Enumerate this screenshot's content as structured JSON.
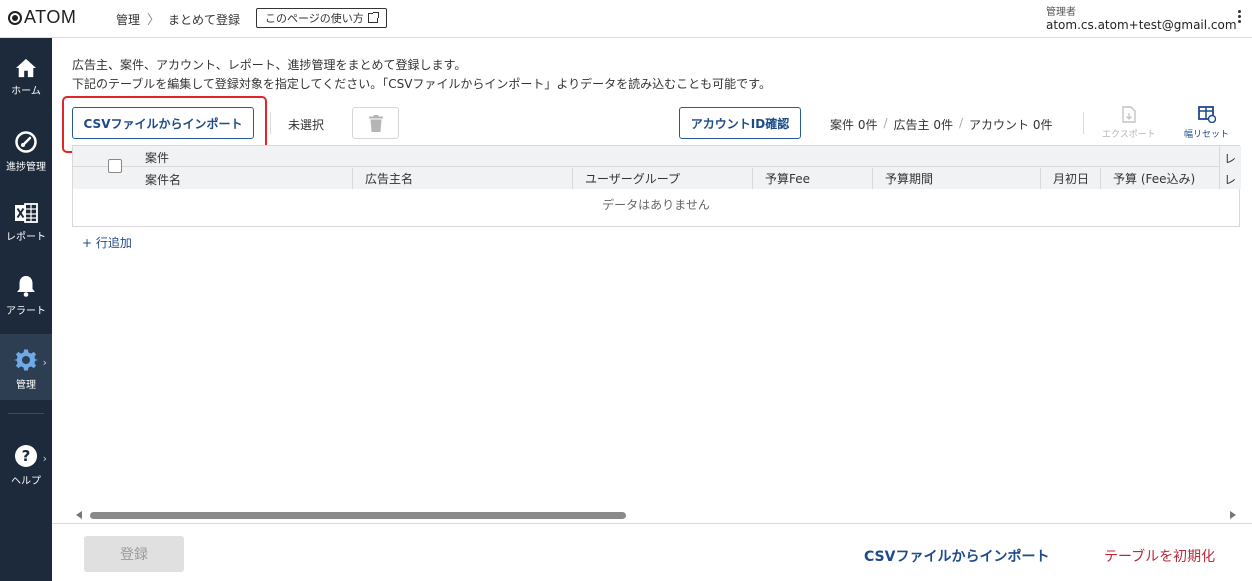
{
  "header": {
    "logo": "ATOM",
    "breadcrumb": [
      "管理",
      "まとめて登録"
    ],
    "breadcrumb_sep": "〉",
    "howto_label": "このページの使い方",
    "user_role": "管理者",
    "user_email": "atom.cs.atom+test@gmail.com"
  },
  "sidebar": {
    "items": [
      {
        "label": "ホーム",
        "icon": "home-icon"
      },
      {
        "label": "進捗管理",
        "icon": "gauge-icon"
      },
      {
        "label": "レポート",
        "icon": "excel-icon"
      },
      {
        "label": "アラート",
        "icon": "bell-icon"
      },
      {
        "label": "管理",
        "icon": "gear-icon",
        "active": true
      },
      {
        "label": "ヘルプ",
        "icon": "help-icon"
      }
    ],
    "chevron": "›"
  },
  "intro": {
    "line1": "広告主、案件、アカウント、レポート、進捗管理をまとめて登録します。",
    "line2": "下記のテーブルを編集して登録対象を指定してください。「CSVファイルからインポート」よりデータを読み込むことも可能です。"
  },
  "toolbar": {
    "csv_import": "CSVファイルからインポート",
    "unselected": "未選択",
    "account_id_check": "アカウントID確認",
    "counts": [
      "案件 0件",
      "広告主 0件",
      "アカウント 0件"
    ],
    "count_sep": "/",
    "export_label": "エクスポート",
    "reset_width_label": "幅リセット"
  },
  "table": {
    "group_header": "案件",
    "first_col": "案件名",
    "columns": [
      "広告主名",
      "ユーザーグループ",
      "予算Fee",
      "予算期間",
      "月初日",
      "予算 (Fee込み)"
    ],
    "right_cut": "レ",
    "right_cut2": "レ",
    "empty_text": "データはありません"
  },
  "add_row": "+ 行追加",
  "footer": {
    "register": "登録",
    "csv_import": "CSVファイルからインポート",
    "reset_table": "テーブルを初期化",
    "link_color": "#1d4a8a",
    "danger_color": "#c0283a"
  }
}
